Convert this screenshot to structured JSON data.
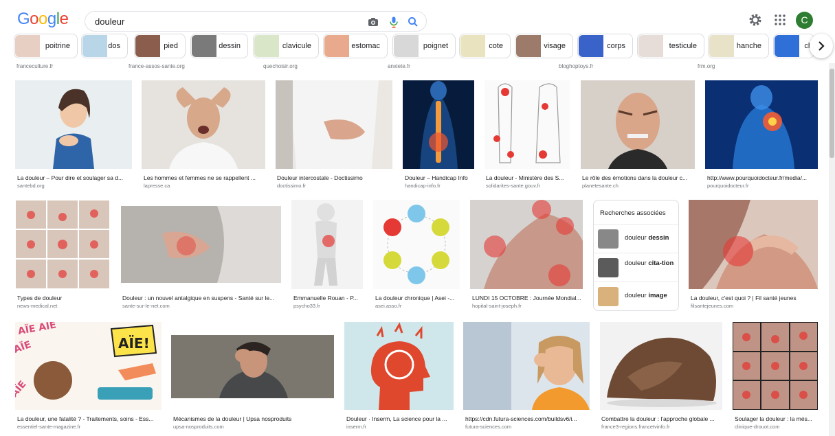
{
  "header": {
    "logo_letters": [
      "G",
      "o",
      "o",
      "g",
      "l",
      "e"
    ],
    "logo_colors": [
      "#4285F4",
      "#EA4335",
      "#FBBC05",
      "#4285F4",
      "#34A853",
      "#EA4335"
    ],
    "search_query": "douleur",
    "avatar_letter": "C"
  },
  "chips": [
    {
      "label": "poitrine",
      "color": "#e8cfc4"
    },
    {
      "label": "dos",
      "color": "#b9d6e8"
    },
    {
      "label": "pied",
      "color": "#8a5d4d"
    },
    {
      "label": "dessin",
      "color": "#7a7a7a"
    },
    {
      "label": "clavicule",
      "color": "#d9e6c8"
    },
    {
      "label": "estomac",
      "color": "#e8a98c"
    },
    {
      "label": "poignet",
      "color": "#d8d8d8"
    },
    {
      "label": "cote",
      "color": "#e9e3c0"
    },
    {
      "label": "visage",
      "color": "#9c7b6a"
    },
    {
      "label": "corps",
      "color": "#3a63c9"
    },
    {
      "label": "testicule",
      "color": "#e6ddd8"
    },
    {
      "label": "hanche",
      "color": "#e8e2c8"
    },
    {
      "label": "ch",
      "color": "#2f6fd8"
    }
  ],
  "top_sources": [
    "franceculture.fr",
    "france-assos-sante.org",
    "quechoisir.org",
    "anxiete.fr",
    "bloghoptoys.fr",
    "frm.org"
  ],
  "row1": [
    {
      "caption": "La douleur – Pour dire et soulager sa d...",
      "source": "santebd.org",
      "color": "#e9eef0"
    },
    {
      "caption": "Les hommes et femmes ne se rappellent ...",
      "source": "lapresse.ca",
      "color": "#d9d4cf"
    },
    {
      "caption": "Douleur intercostale - Doctissimo",
      "source": "doctissimo.fr",
      "color": "#dedad5"
    },
    {
      "caption": "Douleur – Handicap Info",
      "source": "handicap-info.fr",
      "color": "#0c2a55"
    },
    {
      "caption": "La douleur - Ministère des S...",
      "source": "solidarites-sante.gouv.fr",
      "color": "#f2f2f2"
    },
    {
      "caption": "Le rôle des émotions dans la douleur c...",
      "source": "planetesante.ch",
      "color": "#b9a696"
    },
    {
      "caption": "http://www.pourquoidocteur.fr/media/...",
      "source": "pourquoidocteur.fr",
      "color": "#0d3c8c"
    }
  ],
  "row2": [
    {
      "caption": "Types de douleur",
      "source": "news-medical.net",
      "color": "#c9b8ad"
    },
    {
      "caption": "Douleur : un nouvel antalgique en suspens - Santé sur le...",
      "source": "sante-sur-le-net.com",
      "color": "#d2cfcc"
    },
    {
      "caption": "Emmanuelle Rouan - P...",
      "source": "psycho33.fr",
      "color": "#eeeeee"
    },
    {
      "caption": "La douleur chronique | Asei -...",
      "source": "asei.asso.fr",
      "color": "#f6f6f6"
    },
    {
      "caption": "LUNDI 15 OCTOBRE : Journée Mondial...",
      "source": "hopital-saint-joseph.fr",
      "color": "#bfa9a0"
    },
    {
      "caption": "La douleur, c'est quoi ? | Fil santé jeunes",
      "source": "filsantejeunes.com",
      "color": "#c79888"
    }
  ],
  "related": {
    "title": "Recherches associées",
    "items": [
      {
        "prefix": "douleur",
        "bold": "dessin",
        "color": "#888888"
      },
      {
        "prefix": "douleur",
        "bold": "cita-tion",
        "color": "#5b5b5b"
      },
      {
        "prefix": "douleur",
        "bold": "image",
        "color": "#d8b27a"
      }
    ]
  },
  "row3": [
    {
      "caption": "La douleur, une fatalité ? - Traitements, soins - Ess...",
      "source": "essentiel-sante-magazine.fr",
      "color": "#f4e9d6"
    },
    {
      "caption": "Mécanismes de la douleur | Upsa nosproduits",
      "source": "upsa-nosproduits.com",
      "color": "#6e6a62"
    },
    {
      "caption": "Douleur · Inserm, La science pour la ...",
      "source": "inserm.fr",
      "color": "#c8e3e6"
    },
    {
      "caption": "https://cdn.futura-sciences.com/buildsv6/i...",
      "source": "futura-sciences.com",
      "color": "#cfd9e3"
    },
    {
      "caption": "Combattre la douleur : l'approche globale ...",
      "source": "france3-regions.francetvinfo.fr",
      "color": "#7b5a45"
    },
    {
      "caption": "Soulager la douleur : la més...",
      "source": "clinique-drouot.com",
      "color": "#b48f82"
    }
  ]
}
